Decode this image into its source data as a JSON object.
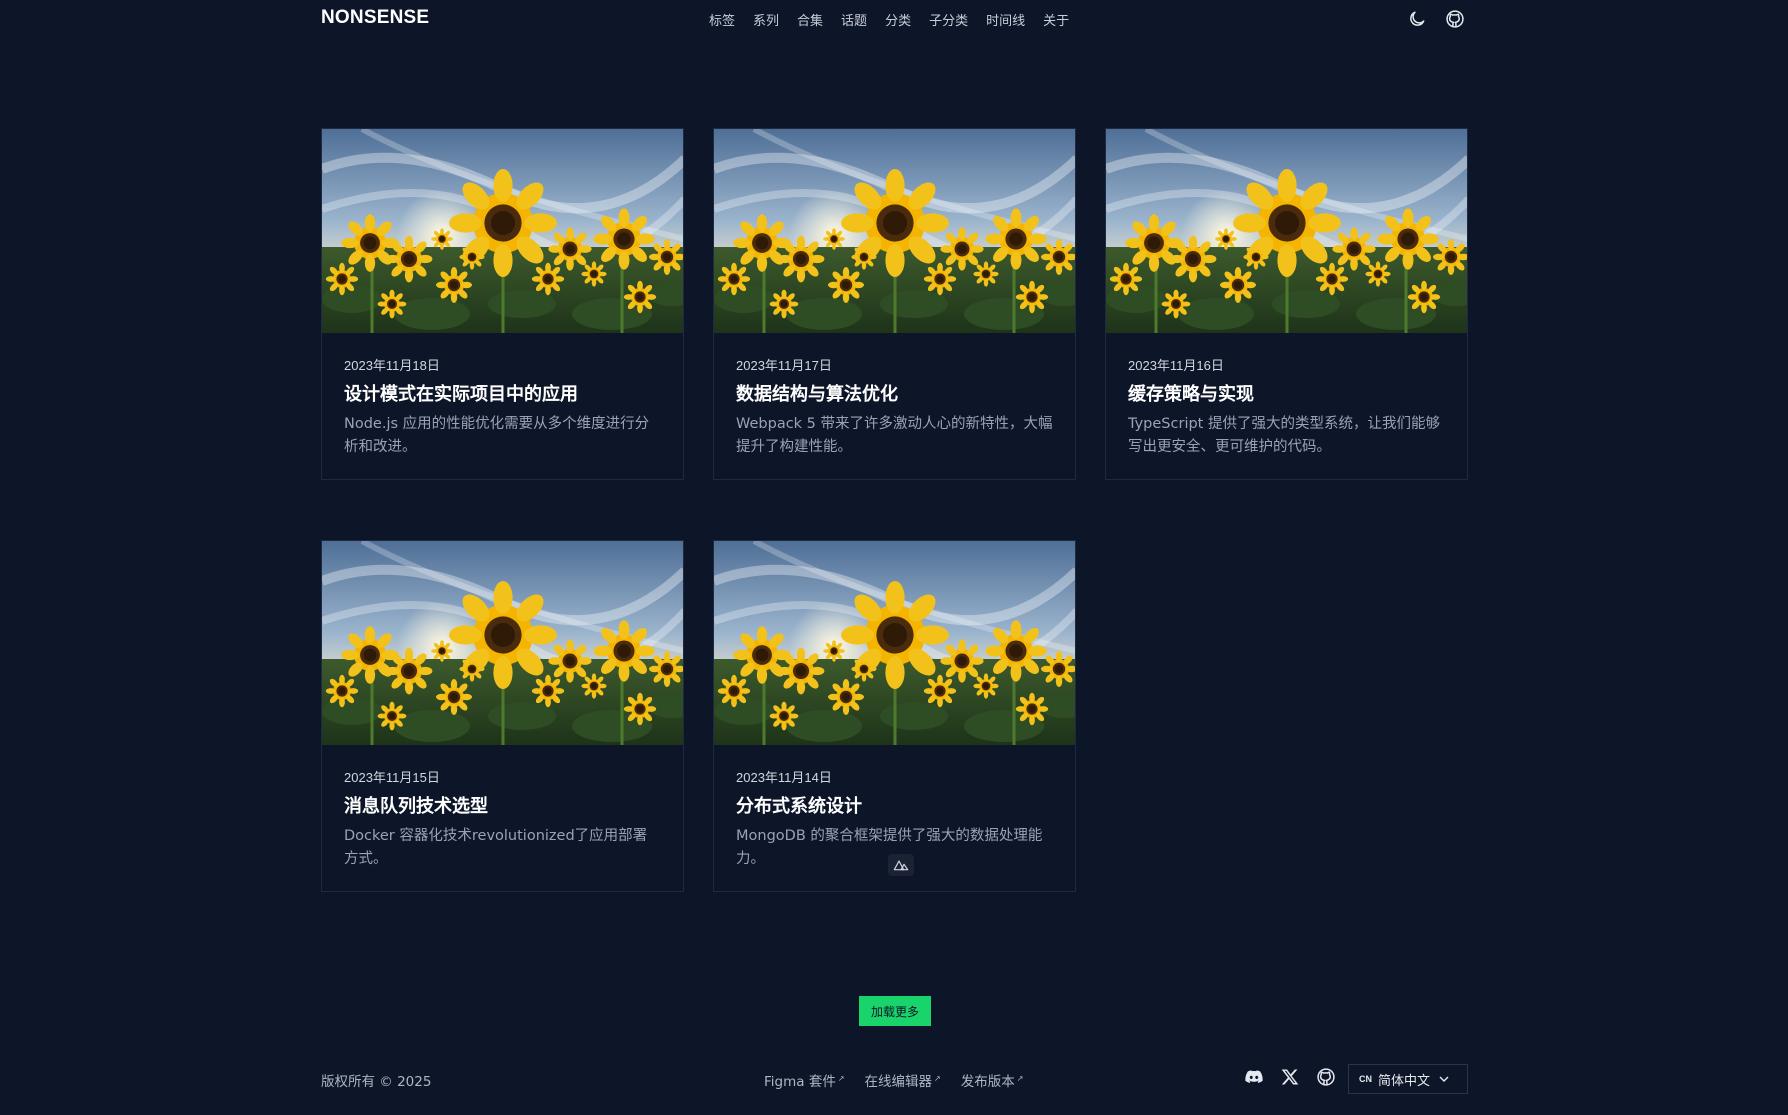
{
  "header": {
    "logo": "NONSENSE",
    "nav": [
      "标签",
      "系列",
      "合集",
      "话题",
      "分类",
      "子分类",
      "时间线",
      "关于"
    ],
    "icons": [
      "moon-icon",
      "github-icon"
    ]
  },
  "posts": [
    {
      "date": "2023年11月18日",
      "title": "设计模式在实际项目中的应用",
      "desc": "Node.js 应用的性能优化需要从多个维度进行分析和改进。"
    },
    {
      "date": "2023年11月17日",
      "title": "数据结构与算法优化",
      "desc": "Webpack 5 带来了许多激动人心的新特性，大幅提升了构建性能。"
    },
    {
      "date": "2023年11月16日",
      "title": "缓存策略与实现",
      "desc": "TypeScript 提供了强大的类型系统，让我们能够写出更安全、更可维护的代码。"
    },
    {
      "date": "2023年11月15日",
      "title": "消息队列技术选型",
      "desc": "Docker 容器化技术revolutionized了应用部署方式。"
    },
    {
      "date": "2023年11月14日",
      "title": "分布式系统设计",
      "desc": "MongoDB 的聚合框架提供了强大的数据处理能力。"
    }
  ],
  "load_more": "加载更多",
  "footer": {
    "copyright": "版权所有 © 2025",
    "links": [
      "Figma 套件",
      "在线编辑器",
      "发布版本"
    ],
    "external_mark": "↗",
    "icons": [
      "discord-icon",
      "x-icon",
      "github-icon"
    ],
    "lang_code": "CN",
    "lang_label": "简体中文"
  },
  "colors": {
    "background": "#0d1528",
    "accent": "#19d36b",
    "card_border": "#1f2940"
  }
}
